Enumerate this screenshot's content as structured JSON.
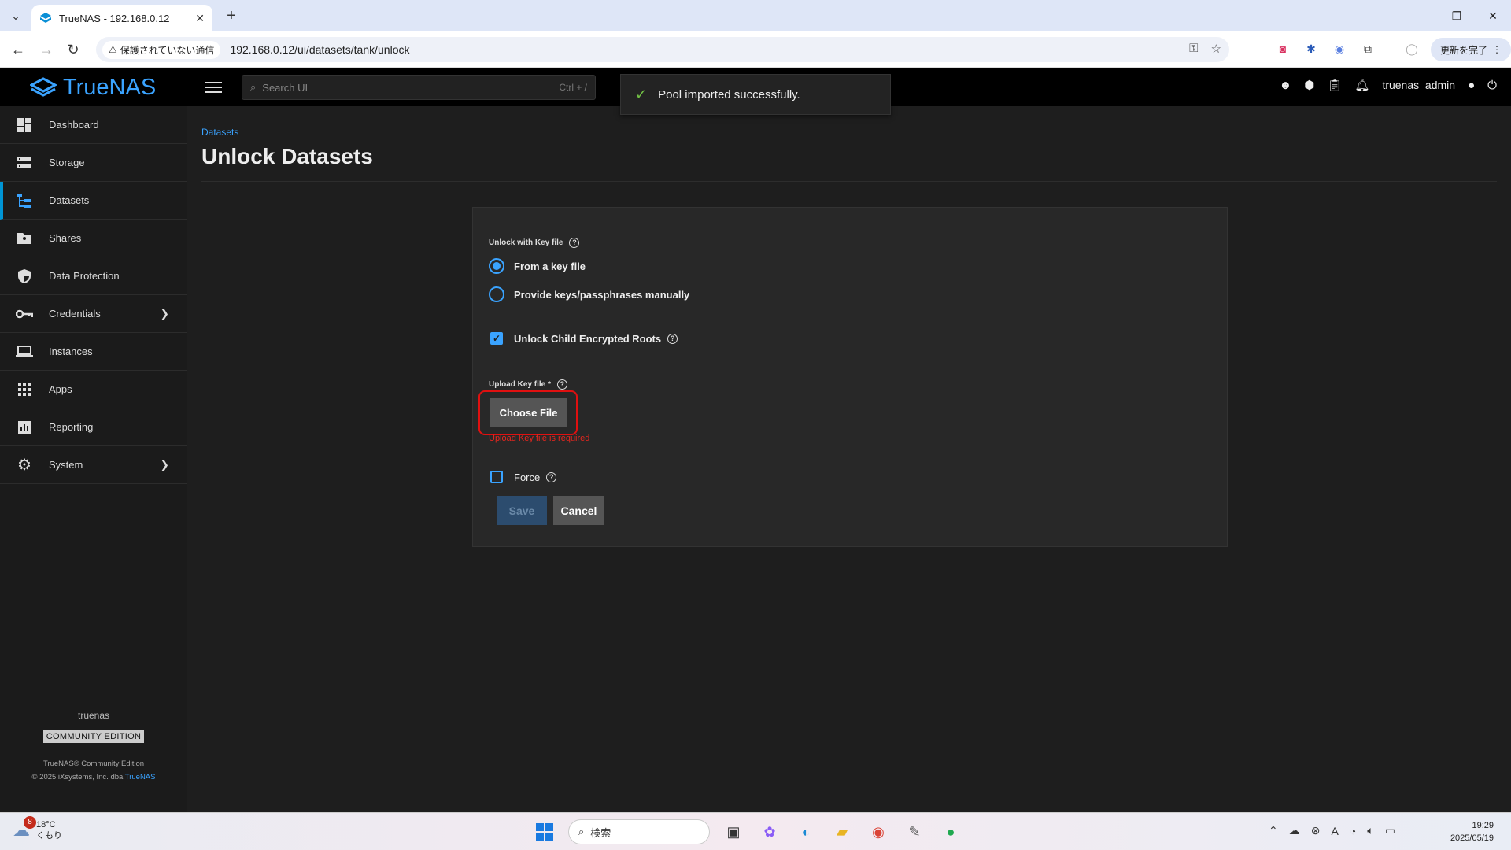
{
  "browser": {
    "tab_title": "TrueNAS - 192.168.0.12",
    "security_label": "保護されていない通信",
    "url": "192.168.0.12/ui/datasets/tank/unlock",
    "update_button": "更新を完了"
  },
  "header": {
    "brand": "TrueNAS",
    "search_placeholder": "Search UI",
    "search_shortcut": "Ctrl + /",
    "username": "truenas_admin"
  },
  "toast": {
    "message": "Pool imported successfully."
  },
  "sidebar": {
    "items": [
      {
        "label": "Dashboard"
      },
      {
        "label": "Storage"
      },
      {
        "label": "Datasets"
      },
      {
        "label": "Shares"
      },
      {
        "label": "Data Protection"
      },
      {
        "label": "Credentials"
      },
      {
        "label": "Instances"
      },
      {
        "label": "Apps"
      },
      {
        "label": "Reporting"
      },
      {
        "label": "System"
      }
    ],
    "hostname": "truenas",
    "edition": "COMMUNITY EDITION",
    "product_line": "TrueNAS® Community Edition",
    "copyright": "© 2025 iXsystems, Inc. dba",
    "copyright_link": "TrueNAS"
  },
  "page": {
    "breadcrumb": "Datasets",
    "title": "Unlock Datasets"
  },
  "form": {
    "unlock_with_label": "Unlock with Key file",
    "radio_key_file": "From a key file",
    "radio_manual": "Provide keys/passphrases manually",
    "unlock_child_label": "Unlock Child Encrypted Roots",
    "upload_label": "Upload Key file *",
    "choose_file": "Choose File",
    "error": "Upload Key file is required",
    "force_label": "Force",
    "save": "Save",
    "cancel": "Cancel"
  },
  "taskbar": {
    "weather_badge": "8",
    "temperature": "18°C",
    "condition": "くもり",
    "search_label": "検索",
    "time": "19:29",
    "date": "2025/05/19"
  }
}
